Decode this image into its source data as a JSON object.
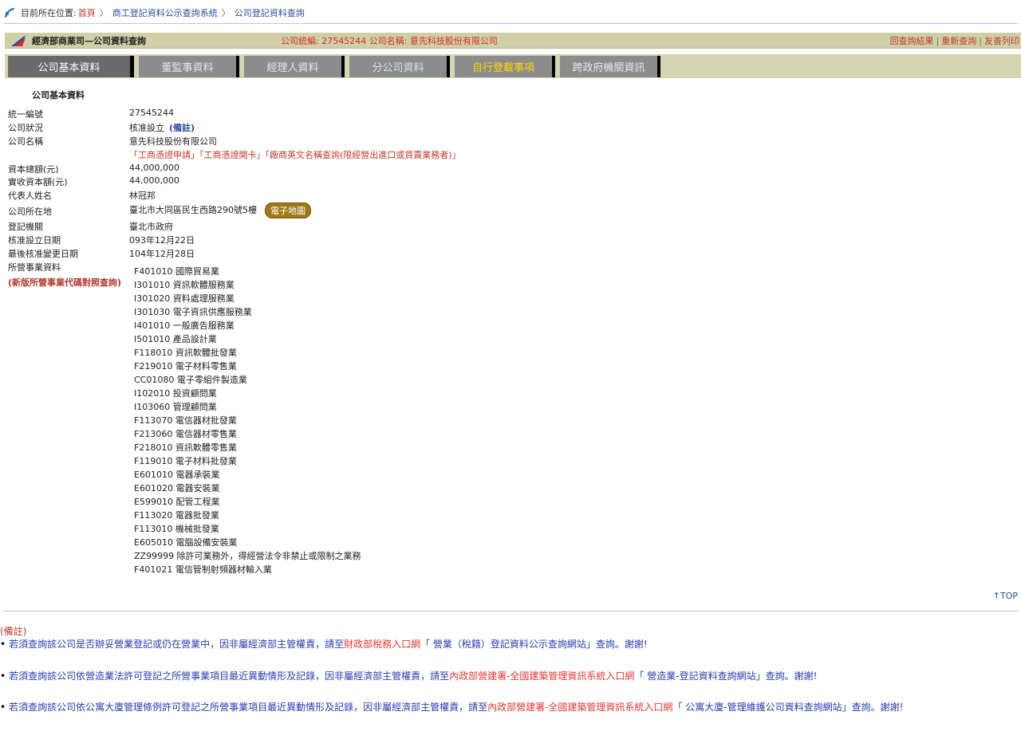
{
  "breadcrumb": {
    "prefix": "目前所在位置:",
    "home": "首頁",
    "system": "商工登記資料公示查詢系統",
    "current": "公司登記資料查詢",
    "sep": "〉"
  },
  "header": {
    "site_title": "經濟部商業司—公司資料查詢",
    "summary": "公司統編: 27545244   公司名稱: 意先科技股份有限公司",
    "links": [
      "回查詢結果",
      "重新查詢",
      "友善列印"
    ]
  },
  "tabs": [
    {
      "label": "公司基本資料"
    },
    {
      "label": "董監事資料"
    },
    {
      "label": "經理人資料"
    },
    {
      "label": "分公司資料"
    },
    {
      "label": "自行登載事項"
    },
    {
      "label": "跨政府機關資訊"
    }
  ],
  "section_title": "公司基本資料",
  "fields": {
    "uniform_no_label": "統一編號",
    "uniform_no": "27545244",
    "status_label": "公司狀況",
    "status": "核准設立",
    "status_note": "(備註)",
    "name_label": "公司名稱",
    "name": "意先科技股份有限公司",
    "name_links": "「工商憑證申請」「工商憑證開卡」「廠商英文名稱查詢(限經營出進口或買賣業務者)」",
    "capital_label": "資本總額(元)",
    "capital": "44,000,000",
    "paid_label": "實收資本額(元)",
    "paid": "44,000,000",
    "rep_label": "代表人姓名",
    "rep": "林冠邦",
    "address_label": "公司所在地",
    "address": "臺北市大同區民生西路290號5樓",
    "map_button": "電子地圖",
    "authority_label": "登記機關",
    "authority": "臺北市政府",
    "approve_date_label": "核准設立日期",
    "approve_date": "093年12月22日",
    "change_date_label": "最後核准變更日期",
    "change_date": "104年12月28日",
    "business_label": "所營事業資料",
    "business_code_link": "(新版所營事業代碼對照查詢)"
  },
  "business_items": [
    "F401010  國際貿易業",
    "I301010  資訊軟體服務業",
    "I301020  資料處理服務業",
    "I301030  電子資訊供應服務業",
    "I401010  一般廣告服務業",
    "I501010  產品設計業",
    "F118010  資訊軟體批發業",
    "F219010  電子材料零售業",
    "CC01080  電子零組件製造業",
    "I102010  投資顧問業",
    "I103060  管理顧問業",
    "F113070  電信器材批發業",
    "F213060  電信器材零售業",
    "F218010  資訊軟體零售業",
    "F119010  電子材料批發業",
    "E601010  電器承裝業",
    "E601020  電器安裝業",
    "E599010  配管工程業",
    "F113020  電器批發業",
    "F113010  機械批發業",
    "E605010  電腦設備安裝業",
    "ZZ99999  除許可業務外，得經營法令非禁止或限制之業務",
    "F401021  電信管制射頻器材輸入業"
  ],
  "top_link": "↑TOP",
  "notes": {
    "title": "(備註)",
    "n1_a": "若須查詢該公司是否辦妥營業登記或仍在營業中，因非屬經濟部主管權責，請至",
    "n1_red": "財政部稅務入口網",
    "n1_b": "「 營業（稅籍）登記資料公示查詢網站」查詢。謝謝!",
    "n2_a": "若須查詢該公司依營造業法許可登記之所營事業項目最近異動情形及記錄，因非屬經濟部主管權責，請至",
    "n2_red": "內政部營建署-全國建築管理資訊系統入口網",
    "n2_b": "「 營造業-登記資料查詢網站」查詢。謝謝!",
    "n3_a": "若須查詢該公司依公寓大廈管理條例許可登記之所營事業項目最近異動情形及記錄，因非屬經濟部主管權責，請至",
    "n3_red": "內政部營建署-全國建築管理資訊系統入口網",
    "n3_b": "「 公寓大廈-管理維護公司資料查詢網站」查詢。謝謝!"
  }
}
